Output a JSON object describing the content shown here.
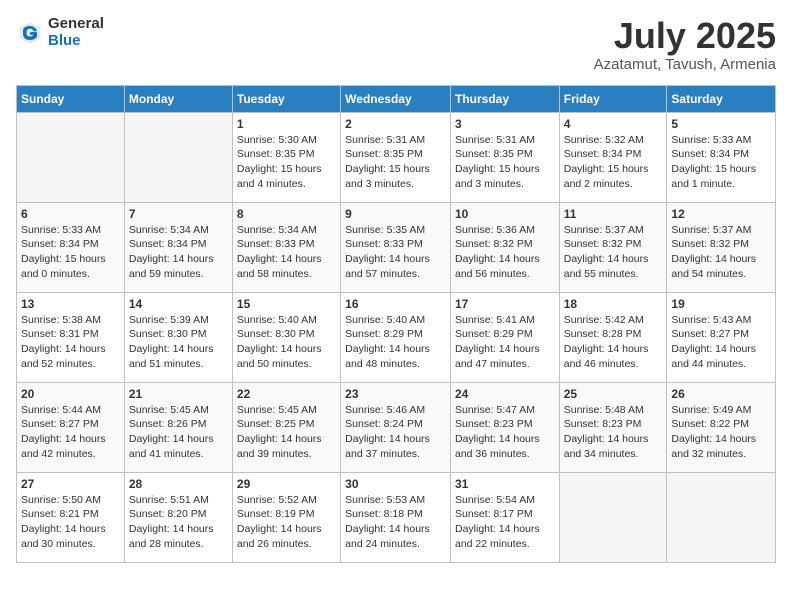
{
  "header": {
    "logo_general": "General",
    "logo_blue": "Blue",
    "month": "July 2025",
    "location": "Azatamut, Tavush, Armenia"
  },
  "days_of_week": [
    "Sunday",
    "Monday",
    "Tuesday",
    "Wednesday",
    "Thursday",
    "Friday",
    "Saturday"
  ],
  "weeks": [
    [
      {
        "day": "",
        "empty": true
      },
      {
        "day": "",
        "empty": true
      },
      {
        "day": "1",
        "sunrise": "5:30 AM",
        "sunset": "8:35 PM",
        "daylight": "15 hours and 4 minutes."
      },
      {
        "day": "2",
        "sunrise": "5:31 AM",
        "sunset": "8:35 PM",
        "daylight": "15 hours and 3 minutes."
      },
      {
        "day": "3",
        "sunrise": "5:31 AM",
        "sunset": "8:35 PM",
        "daylight": "15 hours and 3 minutes."
      },
      {
        "day": "4",
        "sunrise": "5:32 AM",
        "sunset": "8:34 PM",
        "daylight": "15 hours and 2 minutes."
      },
      {
        "day": "5",
        "sunrise": "5:33 AM",
        "sunset": "8:34 PM",
        "daylight": "15 hours and 1 minute."
      }
    ],
    [
      {
        "day": "6",
        "sunrise": "5:33 AM",
        "sunset": "8:34 PM",
        "daylight": "15 hours and 0 minutes."
      },
      {
        "day": "7",
        "sunrise": "5:34 AM",
        "sunset": "8:34 PM",
        "daylight": "14 hours and 59 minutes."
      },
      {
        "day": "8",
        "sunrise": "5:34 AM",
        "sunset": "8:33 PM",
        "daylight": "14 hours and 58 minutes."
      },
      {
        "day": "9",
        "sunrise": "5:35 AM",
        "sunset": "8:33 PM",
        "daylight": "14 hours and 57 minutes."
      },
      {
        "day": "10",
        "sunrise": "5:36 AM",
        "sunset": "8:32 PM",
        "daylight": "14 hours and 56 minutes."
      },
      {
        "day": "11",
        "sunrise": "5:37 AM",
        "sunset": "8:32 PM",
        "daylight": "14 hours and 55 minutes."
      },
      {
        "day": "12",
        "sunrise": "5:37 AM",
        "sunset": "8:32 PM",
        "daylight": "14 hours and 54 minutes."
      }
    ],
    [
      {
        "day": "13",
        "sunrise": "5:38 AM",
        "sunset": "8:31 PM",
        "daylight": "14 hours and 52 minutes."
      },
      {
        "day": "14",
        "sunrise": "5:39 AM",
        "sunset": "8:30 PM",
        "daylight": "14 hours and 51 minutes."
      },
      {
        "day": "15",
        "sunrise": "5:40 AM",
        "sunset": "8:30 PM",
        "daylight": "14 hours and 50 minutes."
      },
      {
        "day": "16",
        "sunrise": "5:40 AM",
        "sunset": "8:29 PM",
        "daylight": "14 hours and 48 minutes."
      },
      {
        "day": "17",
        "sunrise": "5:41 AM",
        "sunset": "8:29 PM",
        "daylight": "14 hours and 47 minutes."
      },
      {
        "day": "18",
        "sunrise": "5:42 AM",
        "sunset": "8:28 PM",
        "daylight": "14 hours and 46 minutes."
      },
      {
        "day": "19",
        "sunrise": "5:43 AM",
        "sunset": "8:27 PM",
        "daylight": "14 hours and 44 minutes."
      }
    ],
    [
      {
        "day": "20",
        "sunrise": "5:44 AM",
        "sunset": "8:27 PM",
        "daylight": "14 hours and 42 minutes."
      },
      {
        "day": "21",
        "sunrise": "5:45 AM",
        "sunset": "8:26 PM",
        "daylight": "14 hours and 41 minutes."
      },
      {
        "day": "22",
        "sunrise": "5:45 AM",
        "sunset": "8:25 PM",
        "daylight": "14 hours and 39 minutes."
      },
      {
        "day": "23",
        "sunrise": "5:46 AM",
        "sunset": "8:24 PM",
        "daylight": "14 hours and 37 minutes."
      },
      {
        "day": "24",
        "sunrise": "5:47 AM",
        "sunset": "8:23 PM",
        "daylight": "14 hours and 36 minutes."
      },
      {
        "day": "25",
        "sunrise": "5:48 AM",
        "sunset": "8:23 PM",
        "daylight": "14 hours and 34 minutes."
      },
      {
        "day": "26",
        "sunrise": "5:49 AM",
        "sunset": "8:22 PM",
        "daylight": "14 hours and 32 minutes."
      }
    ],
    [
      {
        "day": "27",
        "sunrise": "5:50 AM",
        "sunset": "8:21 PM",
        "daylight": "14 hours and 30 minutes."
      },
      {
        "day": "28",
        "sunrise": "5:51 AM",
        "sunset": "8:20 PM",
        "daylight": "14 hours and 28 minutes."
      },
      {
        "day": "29",
        "sunrise": "5:52 AM",
        "sunset": "8:19 PM",
        "daylight": "14 hours and 26 minutes."
      },
      {
        "day": "30",
        "sunrise": "5:53 AM",
        "sunset": "8:18 PM",
        "daylight": "14 hours and 24 minutes."
      },
      {
        "day": "31",
        "sunrise": "5:54 AM",
        "sunset": "8:17 PM",
        "daylight": "14 hours and 22 minutes."
      },
      {
        "day": "",
        "empty": true
      },
      {
        "day": "",
        "empty": true
      }
    ]
  ],
  "labels": {
    "sunrise": "Sunrise:",
    "sunset": "Sunset:",
    "daylight": "Daylight:"
  }
}
